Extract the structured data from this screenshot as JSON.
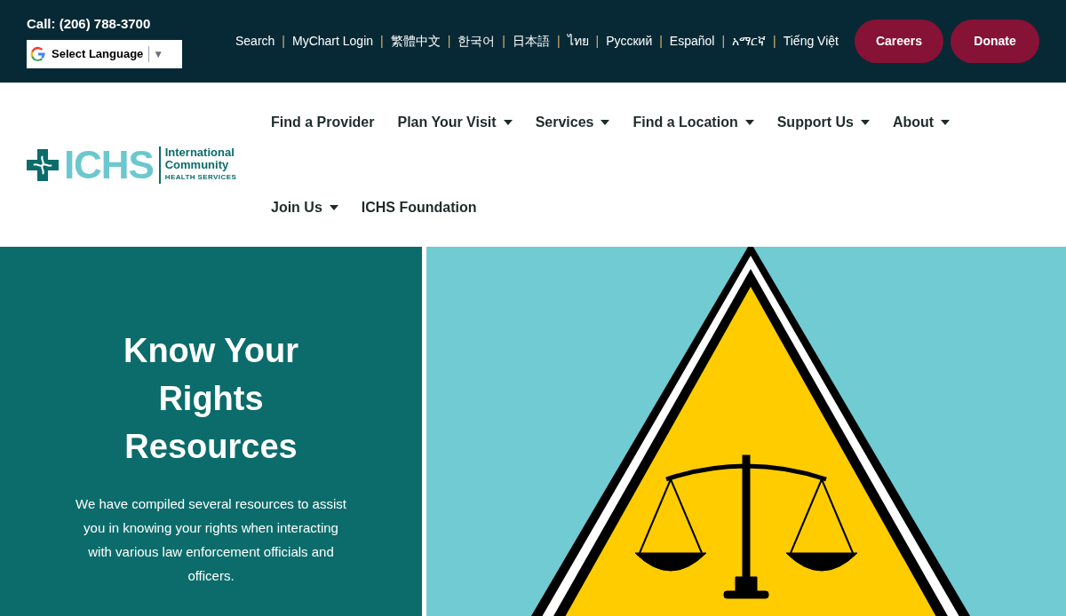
{
  "top_bar": {
    "phone": "Call: (206) 788-3700",
    "language_select": {
      "label": "Select Language",
      "arrow": "▼"
    },
    "links": [
      {
        "label": "Search"
      },
      {
        "label": "MyChart Login"
      },
      {
        "label": "繁體中文"
      },
      {
        "label": "한국어"
      },
      {
        "label": "日本語"
      },
      {
        "label": "ไทย"
      },
      {
        "label": "Русский"
      },
      {
        "label": "Español"
      },
      {
        "label": "አማርኛ"
      },
      {
        "label": "Tiếng Việt"
      }
    ],
    "separator": "|",
    "buttons": [
      {
        "label": "Careers"
      },
      {
        "label": "Donate"
      }
    ]
  },
  "logo": {
    "mark": "ICHS",
    "line_1": "International",
    "line_2": "Community",
    "line_3": "HEALTH SERVICES"
  },
  "nav": [
    {
      "label": "Find a Provider",
      "dropdown": false
    },
    {
      "label": "Plan Your Visit",
      "dropdown": true
    },
    {
      "label": "Services",
      "dropdown": true
    },
    {
      "label": "Find a Location",
      "dropdown": true
    },
    {
      "label": "Support Us",
      "dropdown": true
    },
    {
      "label": "About",
      "dropdown": true
    },
    {
      "label": "Join Us",
      "dropdown": true
    },
    {
      "label": "ICHS Foundation",
      "dropdown": false
    }
  ],
  "hero": {
    "title": "Know Your Rights Resources",
    "text": "We have compiled several resources to assist you in knowing your rights when interacting with various law enforcement officials and officers."
  }
}
